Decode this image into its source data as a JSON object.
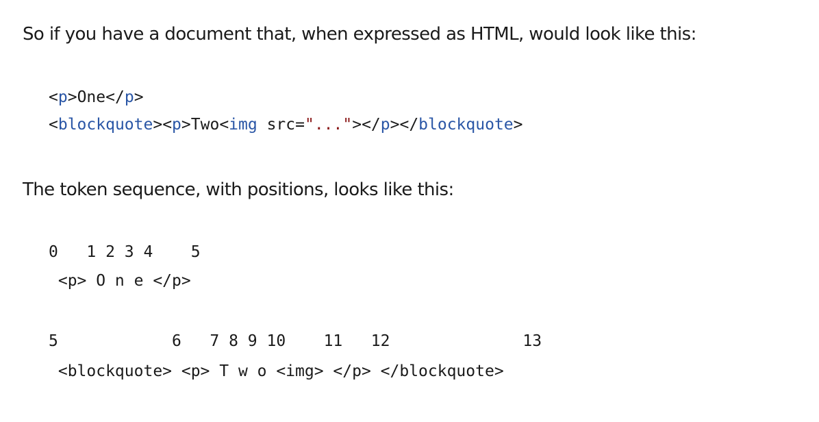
{
  "paragraphs": {
    "intro": "So if you have a document that, when expressed as HTML, would look like this:",
    "token_intro": "The token sequence, with positions, looks like this:"
  },
  "html_example": {
    "line1": {
      "lt1": "<",
      "tag1": "p",
      "gt1": ">",
      "text": "One",
      "lt2": "</",
      "tag2": "p",
      "gt2": ">"
    },
    "line2": {
      "lt1": "<",
      "tag_blockquote": "blockquote",
      "gt1": "><",
      "tag_p": "p",
      "gt2": ">",
      "text": "Two",
      "lt3": "<",
      "tag_img": "img",
      "attr": " src=",
      "attr_value": "\"...\"",
      "gt3": "></",
      "tag_p_close": "p",
      "gt4": "></",
      "tag_blockquote_close": "blockquote",
      "gt5": ">"
    }
  },
  "token_table_1": {
    "positions": "0   1 2 3 4    5",
    "tokens": " <p> O n e </p>"
  },
  "token_table_2": {
    "positions": "5            6   7 8 9 10    11   12              13",
    "tokens": " <blockquote> <p> T w o <img> </p> </blockquote>"
  }
}
